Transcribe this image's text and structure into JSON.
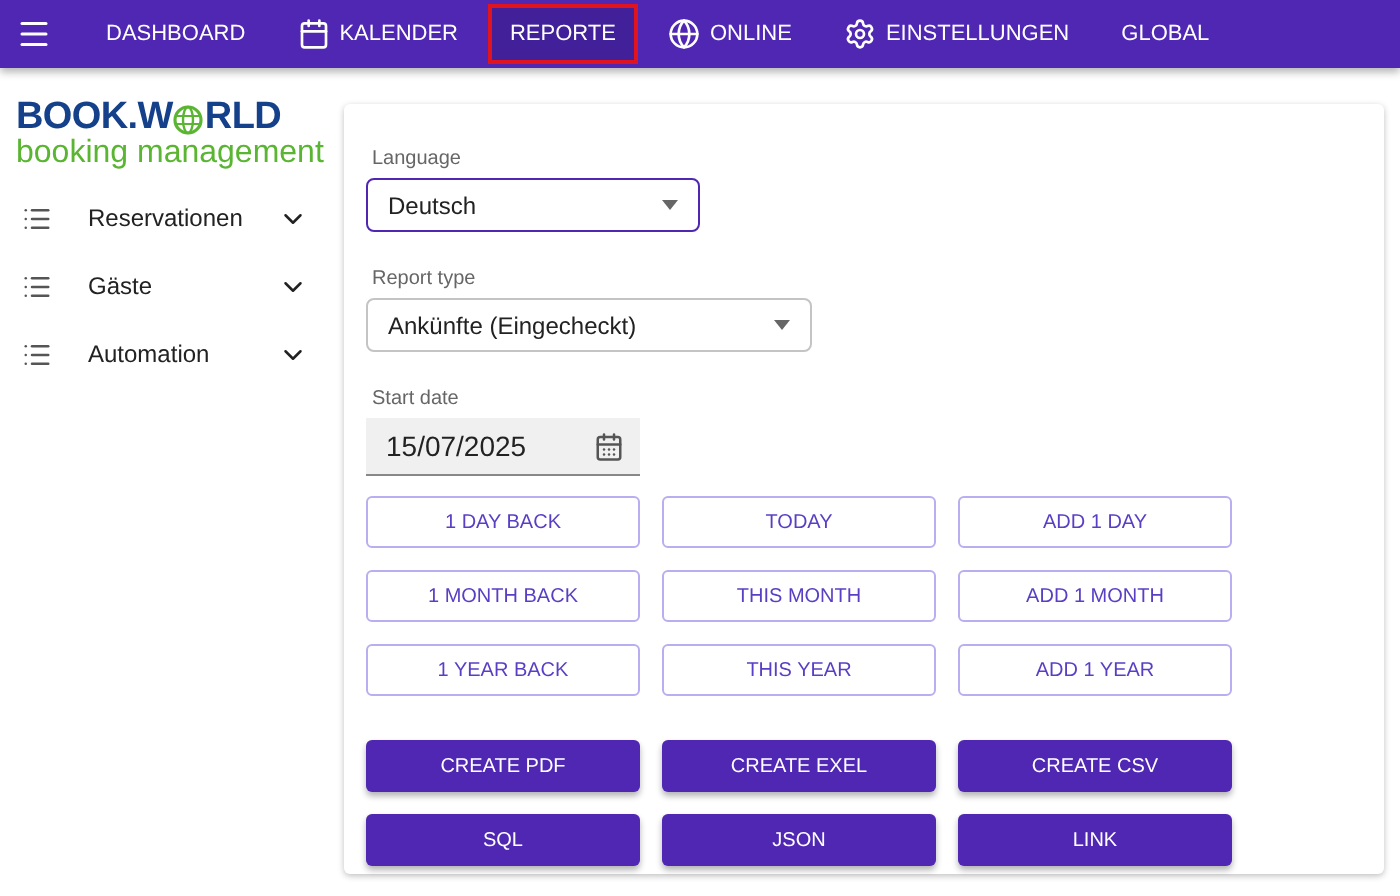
{
  "nav": [
    {
      "label": "DASHBOARD",
      "selected": false
    },
    {
      "label": "KALENDER",
      "selected": false
    },
    {
      "label": "REPORTE",
      "selected": true
    },
    {
      "label": "ONLINE",
      "selected": false
    },
    {
      "label": "EINSTELLUNGEN",
      "selected": false
    },
    {
      "label": "GLOBAL",
      "selected": false
    }
  ],
  "logo": {
    "left": "BOOK.W",
    "right": "RLD",
    "tagline": "booking management"
  },
  "sidebar": {
    "items": [
      {
        "label": "Reservationen",
        "expanded": false
      },
      {
        "label": "Gäste",
        "expanded": false
      },
      {
        "label": "Automation",
        "expanded": false
      }
    ]
  },
  "form": {
    "language": {
      "label": "Language",
      "value": "Deutsch",
      "focused": true
    },
    "report_type": {
      "label": "Report type",
      "value": "Ankünfte (Eingecheckt)",
      "focused": false
    },
    "start_date": {
      "label": "Start date",
      "value": "15/07/2025"
    }
  },
  "date_buttons": [
    [
      "1 DAY BACK",
      "TODAY",
      "ADD 1 DAY"
    ],
    [
      "1 MONTH BACK",
      "THIS MONTH",
      "ADD 1 MONTH"
    ],
    [
      "1 YEAR BACK",
      "THIS YEAR",
      "ADD 1 YEAR"
    ]
  ],
  "action_buttons": [
    [
      "CREATE PDF",
      "CREATE EXEL",
      "CREATE CSV"
    ],
    [
      "SQL",
      "JSON",
      "LINK"
    ]
  ]
}
